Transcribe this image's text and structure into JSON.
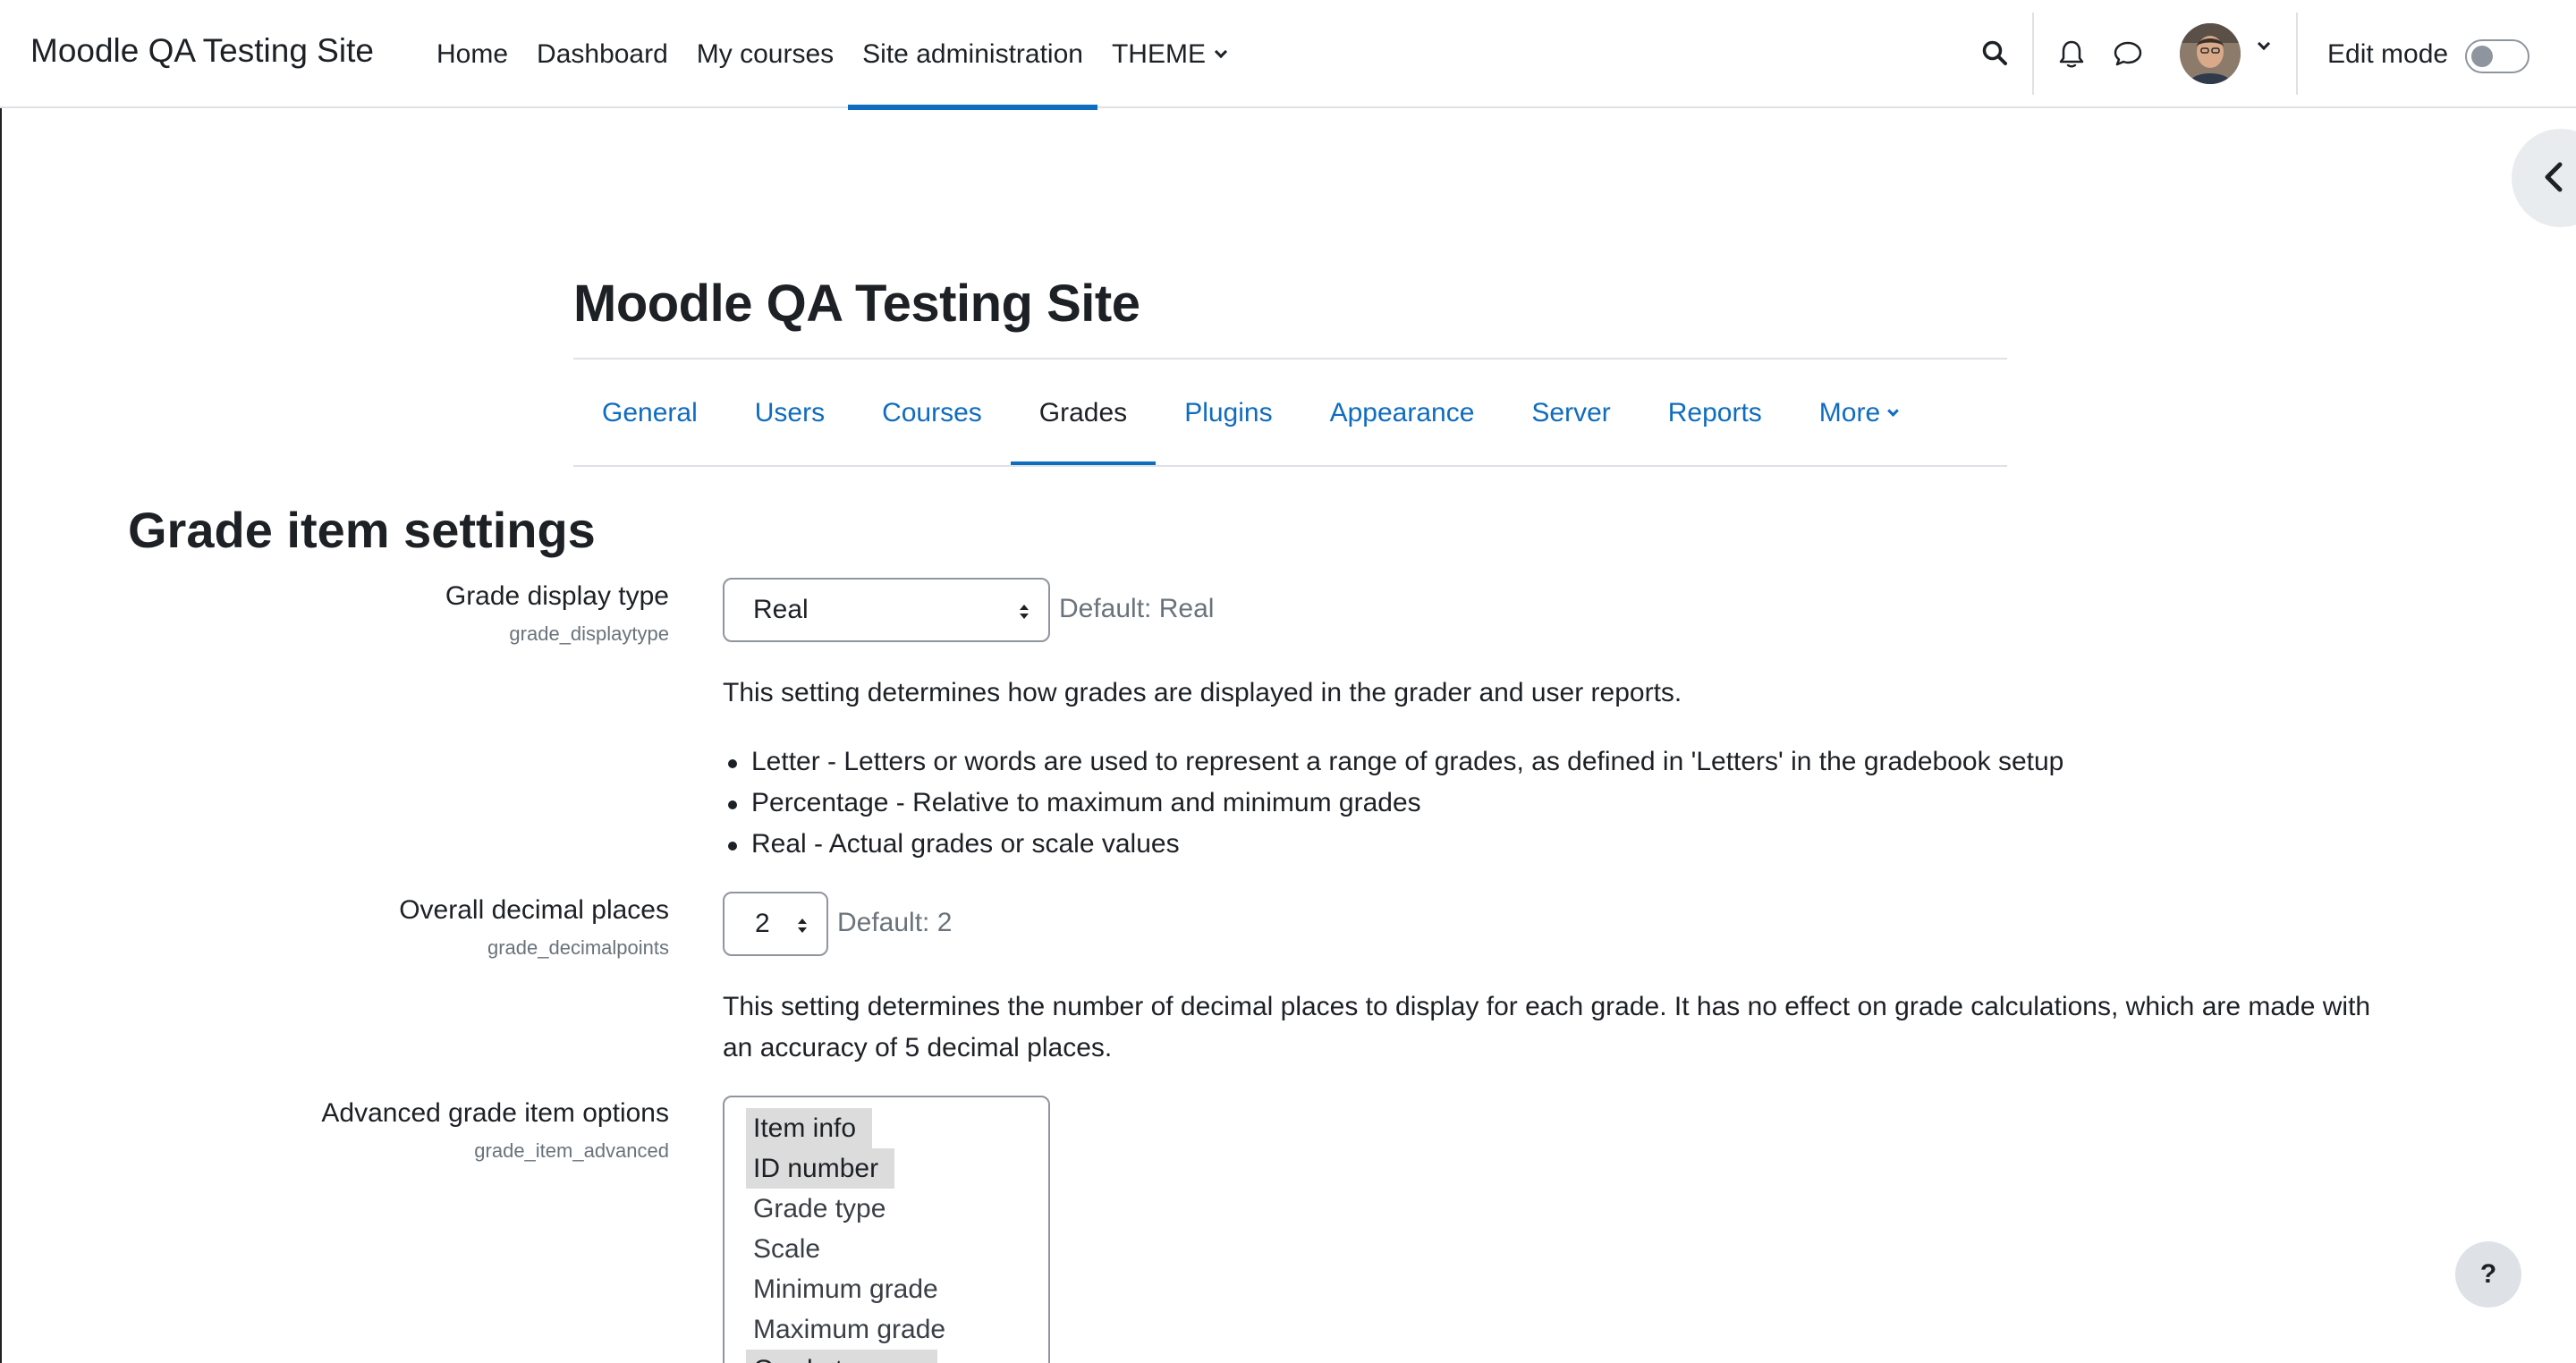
{
  "navbar": {
    "brand": "Moodle QA Testing Site",
    "items": [
      {
        "label": "Home"
      },
      {
        "label": "Dashboard"
      },
      {
        "label": "My courses"
      },
      {
        "label": "Site administration"
      },
      {
        "label": "THEME"
      }
    ],
    "active_item": "Site administration",
    "accent_color": "#0f6cbf",
    "edit_mode_label": "Edit mode",
    "edit_mode_on": false
  },
  "header": {
    "title": "Moodle QA Testing Site",
    "tabs": [
      {
        "label": "General"
      },
      {
        "label": "Users"
      },
      {
        "label": "Courses"
      },
      {
        "label": "Grades"
      },
      {
        "label": "Plugins"
      },
      {
        "label": "Appearance"
      },
      {
        "label": "Server"
      },
      {
        "label": "Reports"
      },
      {
        "label": "More"
      }
    ],
    "active_tab": "Grades"
  },
  "main": {
    "heading": "Grade item settings",
    "settings": [
      {
        "label": "Grade display type",
        "name": "grade_displaytype",
        "value": "Real",
        "default": "Default: Real",
        "description": "This setting determines how grades are displayed in the grader and user reports.",
        "bullets": [
          "Letter - Letters or words are used to represent a range of grades, as defined in 'Letters' in the gradebook setup",
          "Percentage - Relative to maximum and minimum grades",
          "Real - Actual grades or scale values"
        ]
      },
      {
        "label": "Overall decimal places",
        "name": "grade_decimalpoints",
        "value": "2",
        "default": "Default: 2",
        "description_line1": "This setting determines the number of decimal places to display for each grade. It has no effect on grade calculations, which are made with",
        "description_line2": "an accuracy of 5 decimal places."
      },
      {
        "label": "Advanced grade item options",
        "name": "grade_item_advanced",
        "options": [
          {
            "label": "Item info",
            "selected": true
          },
          {
            "label": "ID number",
            "selected": true
          },
          {
            "label": "Grade type",
            "selected": false
          },
          {
            "label": "Scale",
            "selected": false
          },
          {
            "label": "Minimum grade",
            "selected": false
          },
          {
            "label": "Maximum grade",
            "selected": false
          },
          {
            "label": "Grade to pass",
            "selected": true
          }
        ]
      }
    ]
  },
  "help_button": "?",
  "icons": [
    "search-icon",
    "bell-icon",
    "chat-icon",
    "chevron-down-icon",
    "chevron-left-icon",
    "question-icon"
  ]
}
